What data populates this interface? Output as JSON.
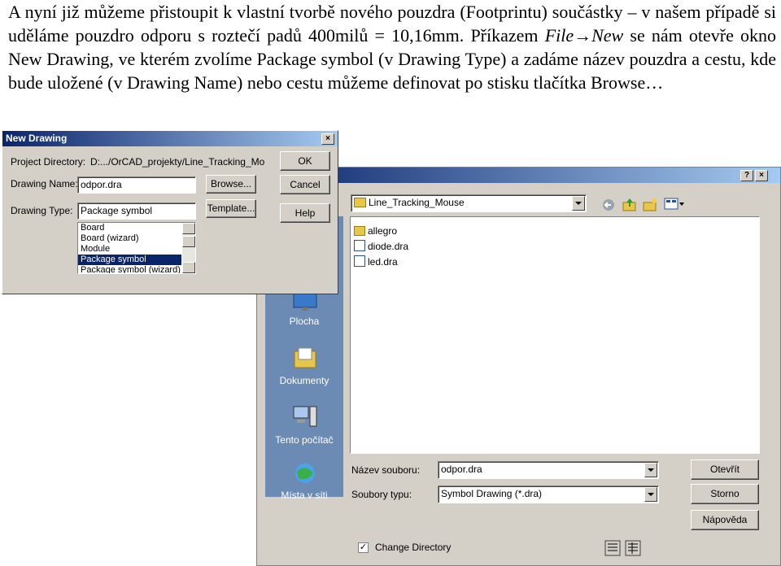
{
  "text": {
    "line1": "A nyní již můžeme přistoupit k vlastní tvorbě nového pouzdra (Footprintu) součástky – v našem případě si uděláme pouzdro odporu s roztečí padů 400milů = 10,16mm. Příkazem",
    "menu_path": "File→New",
    "line2": "se nám otevře okno New Drawing, ve kterém zvolíme Package symbol (v Drawing Type) a zadáme název pouzdra a cestu, kde bude uložené (v Drawing Name) nebo cestu můžeme definovat po stisku tlačítka Browse…"
  },
  "new_drawing": {
    "title": "New Drawing",
    "project_directory_label": "Project Directory:",
    "project_directory_value": "D:.../OrCAD_projekty/Line_Tracking_Mo",
    "drawing_name_label": "Drawing Name:",
    "drawing_name_value": "odpor.dra",
    "drawing_type_label": "Drawing Type:",
    "drawing_type_value": "Package symbol",
    "types": [
      "Board",
      "Board (wizard)",
      "Module",
      "Package symbol",
      "Package symbol (wizard)"
    ],
    "ok": "OK",
    "cancel": "Cancel",
    "help": "Help",
    "browse": "Browse...",
    "template": "Template...",
    "close": "×"
  },
  "file_dialog": {
    "help_btn": "?",
    "close_btn": "×",
    "look_in": "Line_Tracking_Mouse",
    "places": [
      "Plocha",
      "Dokumenty",
      "Tento počítač",
      "Místa v síti"
    ],
    "files": [
      "allegro",
      "diode.dra",
      "led.dra"
    ],
    "filename_label": "Název souboru:",
    "filename_value": "odpor.dra",
    "filetype_label": "Soubory typu:",
    "filetype_value": "Symbol Drawing (*.dra)",
    "open": "Otevřít",
    "cancel": "Storno",
    "help": "Nápověda",
    "change_dir": "Change Directory"
  },
  "colors": {
    "title_start": "#0a246a",
    "title_end": "#a6caf0",
    "face": "#d4d0c8",
    "places_bg": "#6b8ab4",
    "select": "#0a246a"
  }
}
